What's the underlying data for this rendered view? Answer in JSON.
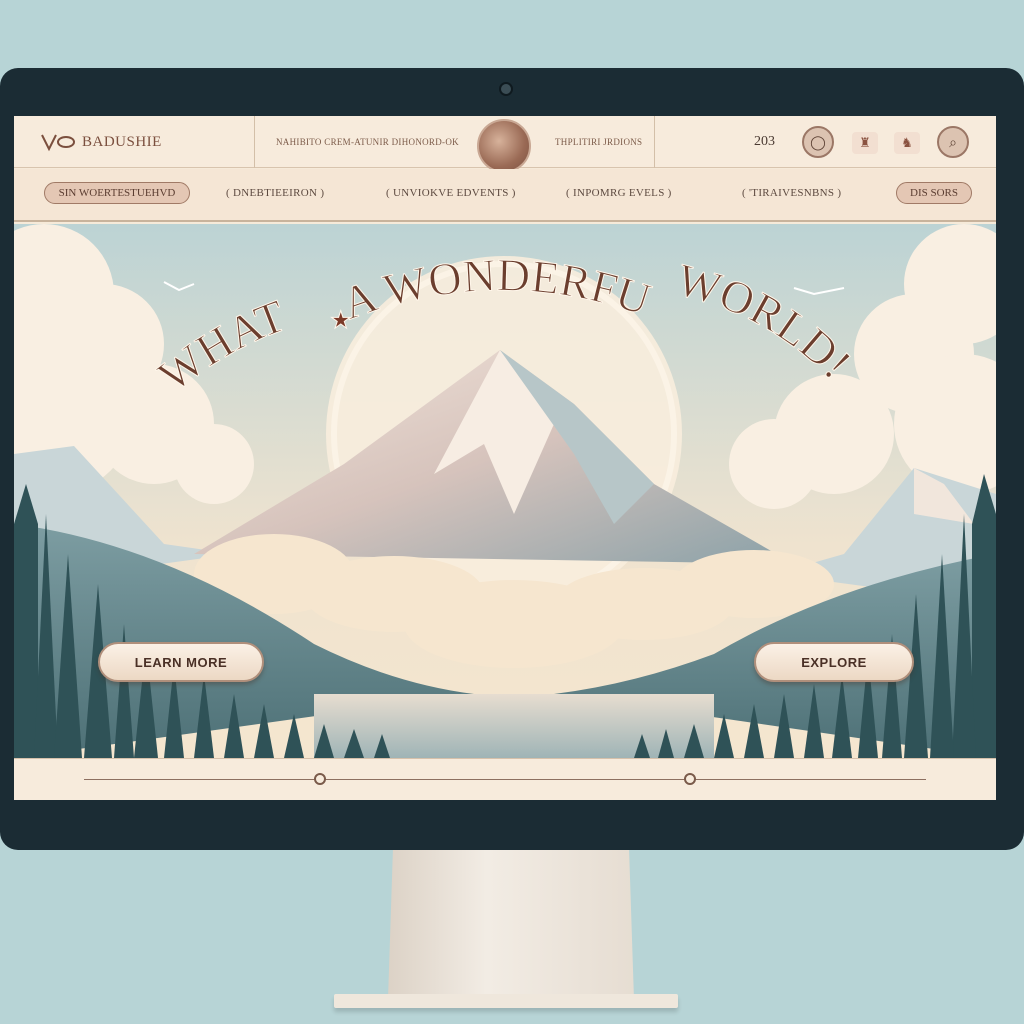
{
  "header": {
    "brand": "BADUSHIE",
    "tagline_left": "NAHIBITO CREM-ATUNIR DIHONORD-OK",
    "tagline_right": "THPLITIRI JRDIONS",
    "number": "203"
  },
  "nav": {
    "items": [
      {
        "label": "SIN WOERTESTUEHVD",
        "style": "pill"
      },
      {
        "label": "( DNEBTIEEIRON )",
        "style": "plain"
      },
      {
        "label": "( UNVIOKVE EDVENTS )",
        "style": "plain"
      },
      {
        "label": "( INPOMRG EVELS )",
        "style": "plain"
      },
      {
        "label": "( 'TIRAIVESNBNS )",
        "style": "plain"
      },
      {
        "label": "DIS SORS",
        "style": "pill"
      }
    ]
  },
  "hero": {
    "title_part1": "WHAT",
    "title_star": "★",
    "title_part2": "A WONDERFUL",
    "title_part3": "WORLD!",
    "learn_more": "LEARN MORE",
    "explore": "EXPLORE"
  },
  "slider": {
    "positions": [
      0.28,
      0.72
    ]
  },
  "icons": {
    "logo": "v-mark-logo-icon",
    "globe": "globe-icon",
    "user": "user-circle-icon",
    "shop": "bag-icon",
    "cart": "cart-icon",
    "search": "search-icon"
  },
  "colors": {
    "accent": "#7b4f3e",
    "screen_bg": "#f6ead9",
    "bezel": "#1b2c34",
    "wall": "#b7d4d6"
  }
}
